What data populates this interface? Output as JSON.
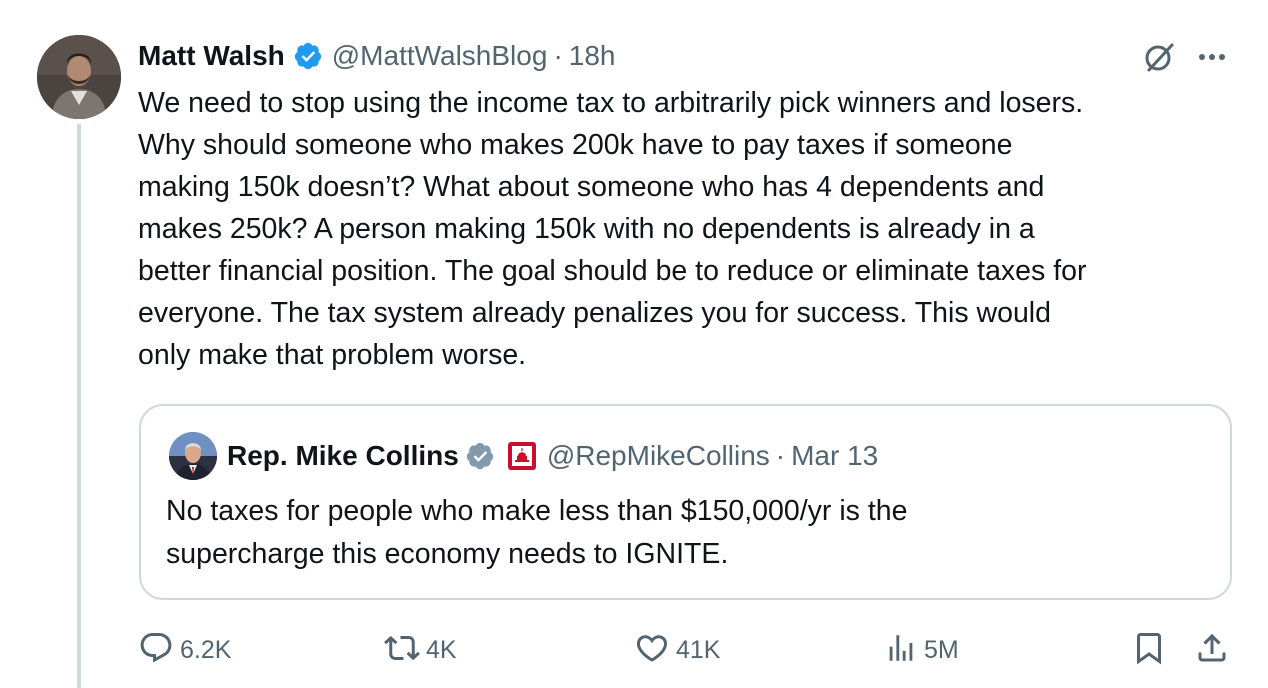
{
  "tweet": {
    "author_name": "Matt Walsh",
    "handle": "@MattWalshBlog",
    "separator": "·",
    "time": "18h",
    "text": "We need to stop using the income tax to arbitrarily pick winners and losers.\nWhy should someone who makes 200k have to pay taxes if someone\nmaking 150k doesn’t? What about someone who has 4 dependents and\nmakes 250k? A person making 150k with no dependents is already in a\nbetter financial position. The goal should be to reduce or eliminate taxes for\neveryone. The tax system already penalizes you for success. This would\nonly make that problem worse."
  },
  "quote": {
    "author_name": "Rep. Mike Collins",
    "handle": "@RepMikeCollins",
    "separator": "·",
    "date": "Mar 13",
    "text": "No taxes for people who make less than $150,000/yr is the\nsupercharge this economy needs to IGNITE."
  },
  "actions": {
    "replies": "6.2K",
    "reposts": "4K",
    "likes": "41K",
    "views": "5M"
  },
  "icons": {
    "verified": "verified-badge-icon",
    "quote_verified": "government-verified-badge-icon",
    "affiliation": "us-capitol-affiliation-icon",
    "grok": "grok-icon",
    "more": "more-dots-icon",
    "reply": "reply-icon",
    "repost": "repost-icon",
    "like": "heart-icon",
    "views": "views-icon",
    "bookmark": "bookmark-icon",
    "share": "share-icon"
  },
  "colors": {
    "text": "#0f1419",
    "secondary": "#536471",
    "border": "#cfd9de",
    "verified_blue": "#1d9bf0",
    "government_gray": "#829aab",
    "affiliation_red": "#c8102e"
  }
}
